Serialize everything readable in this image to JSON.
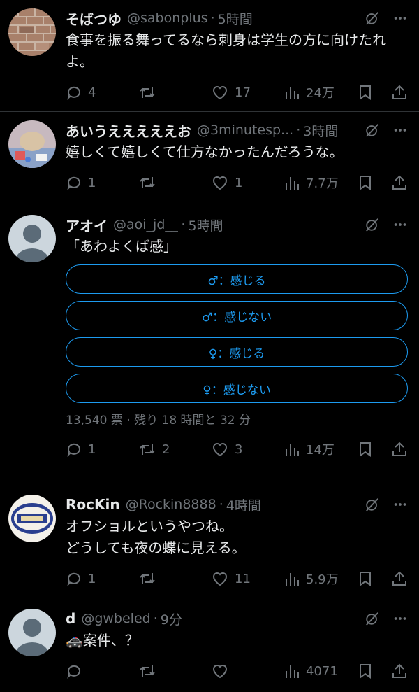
{
  "tweets": [
    {
      "display_name": "そばつゆ",
      "handle": "@sabonplus",
      "time": "5時間",
      "text": "食事を振る舞ってるなら刺身は学生の方に向けたれよ。",
      "replies": "4",
      "retweets": "",
      "likes": "17",
      "views": "24万"
    },
    {
      "display_name": "あいうえええええお",
      "handle": "@3minutesp...",
      "time": "3時間",
      "text": "嬉しくて嬉しくて仕方なかったんだろうな。",
      "replies": "1",
      "retweets": "",
      "likes": "1",
      "views": "7.7万"
    },
    {
      "display_name": "アオイ",
      "handle": "@aoi_jd__",
      "time": "5時間",
      "text": "「あわよくば感」",
      "poll": {
        "options": [
          "♂：感じる",
          "♂：感じない",
          "♀：感じる",
          "♀：感じない"
        ],
        "meta": "13,540 票 · 残り 18 時間と 32 分"
      },
      "replies": "1",
      "retweets": "2",
      "likes": "3",
      "views": "14万"
    },
    {
      "display_name": "RocKin",
      "handle": "@Rockin8888",
      "time": "4時間",
      "text": "オフショルというやつね。\nどうしても夜の蝶に見える。",
      "replies": "1",
      "retweets": "",
      "likes": "11",
      "views": "5.9万"
    },
    {
      "display_name": "d",
      "handle": "@gwbeled",
      "time": "9分",
      "text": "🚓案件、？",
      "replies": "",
      "retweets": "",
      "likes": "",
      "views": "4071"
    }
  ],
  "colors": {
    "background": "#000000",
    "text": "#e7e9ea",
    "muted": "#71767b",
    "accent": "#1d9bf0",
    "divider": "#2f3336"
  },
  "icons": [
    "grok-icon",
    "more-icon",
    "reply-icon",
    "retweet-icon",
    "like-icon",
    "views-icon",
    "bookmark-icon",
    "share-icon",
    "default-avatar-icon"
  ]
}
